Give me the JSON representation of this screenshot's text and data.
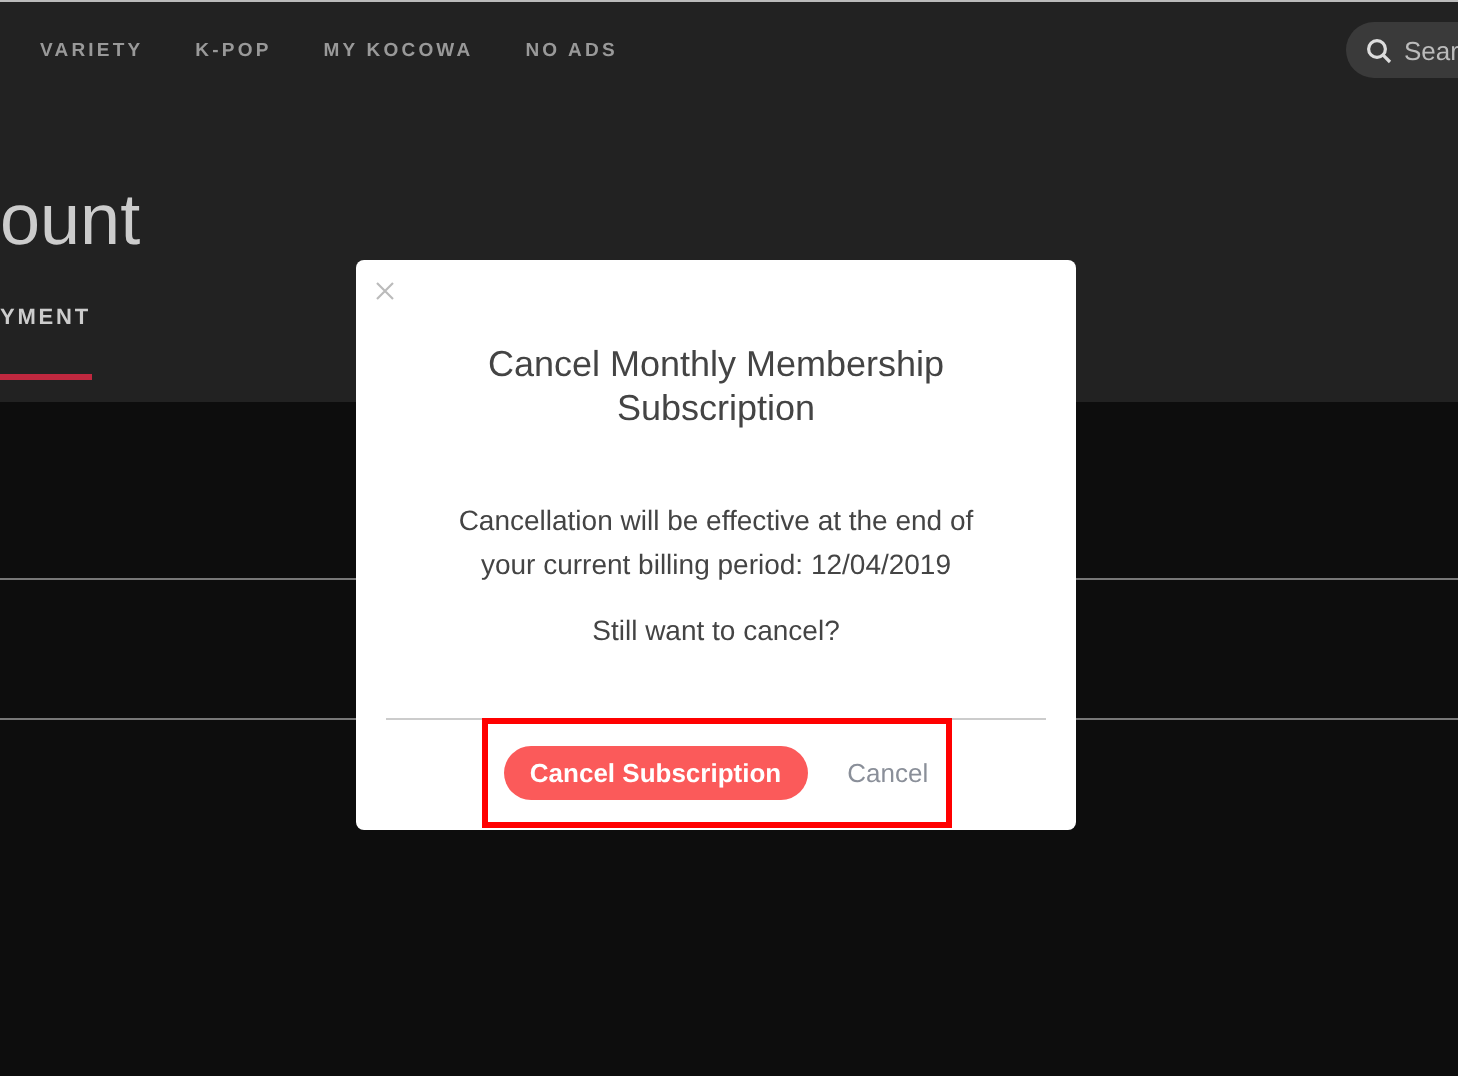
{
  "nav": {
    "items": [
      {
        "label": "VARIETY"
      },
      {
        "label": "K-POP"
      },
      {
        "label": "MY KOCOWA"
      },
      {
        "label": "NO ADS"
      }
    ],
    "search": {
      "placeholder": "Sear"
    }
  },
  "page": {
    "title": "ount",
    "tabs": [
      {
        "label": "YMENT",
        "selected": true
      }
    ]
  },
  "dialog": {
    "title": "Cancel Monthly Membership Subscription",
    "message": "Cancellation will be effective at the end of your current billing period: 12/04/2019",
    "question": "Still want to cancel?",
    "actions_highlighted": true,
    "buttons": [
      {
        "label": "Cancel Subscription",
        "kind": "primary"
      },
      {
        "label": "Cancel",
        "kind": "link"
      }
    ]
  }
}
